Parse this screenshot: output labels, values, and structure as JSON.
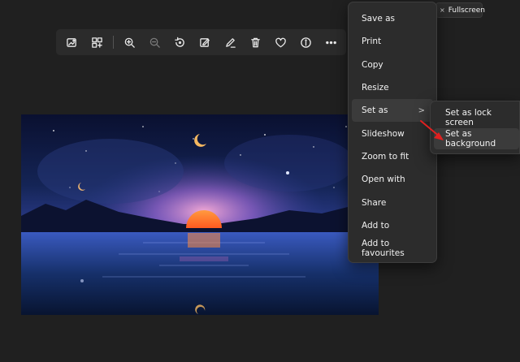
{
  "toolbar": {
    "buttons": [
      {
        "icon": "add-image-icon"
      },
      {
        "icon": "edit-image-icon"
      },
      {
        "icon": "zoom-in-icon"
      },
      {
        "icon": "zoom-out-icon"
      },
      {
        "icon": "rotate-icon"
      },
      {
        "icon": "crop-edit-icon"
      },
      {
        "icon": "draw-icon"
      },
      {
        "icon": "delete-icon"
      },
      {
        "icon": "favorite-heart-icon"
      },
      {
        "icon": "info-icon"
      },
      {
        "icon": "more-icon"
      }
    ]
  },
  "tooltip": {
    "close_glyph": "×",
    "label": "Fullscreen"
  },
  "context_menu": {
    "items": [
      {
        "label": "Save as"
      },
      {
        "label": "Print"
      },
      {
        "label": "Copy"
      },
      {
        "label": "Resize"
      },
      {
        "label": "Set as",
        "submenu": true,
        "chevron": ">"
      },
      {
        "label": "Slideshow"
      },
      {
        "label": "Zoom to fit"
      },
      {
        "label": "Open with"
      },
      {
        "label": "Share"
      },
      {
        "label": "Add to"
      },
      {
        "label": "Add to favourites"
      }
    ]
  },
  "submenu": {
    "items": [
      {
        "label": "Set as lock screen"
      },
      {
        "label": "Set as background"
      }
    ]
  },
  "colors": {
    "background": "#202020",
    "menu_bg": "#2c2c2c",
    "annotation_arrow": "#e02020"
  }
}
